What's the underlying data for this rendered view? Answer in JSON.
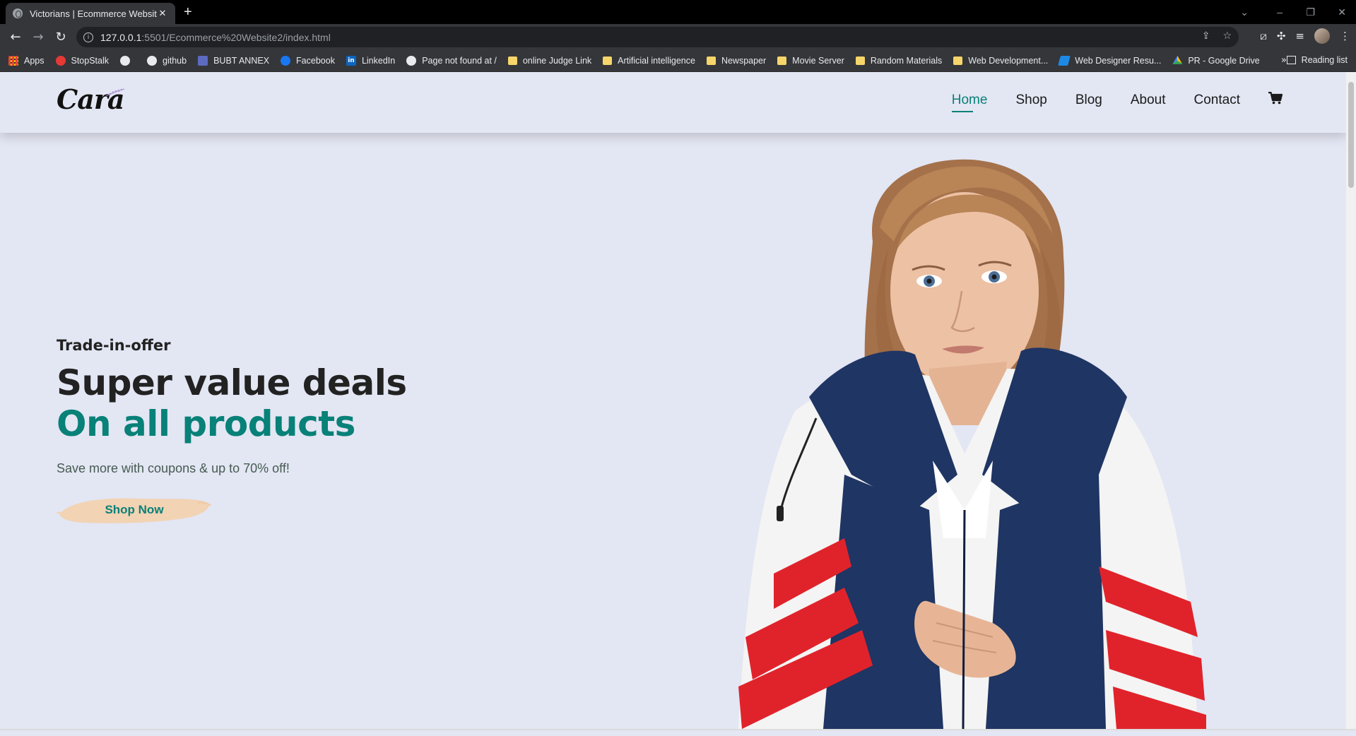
{
  "browser": {
    "tab_title": "Victorians | Ecommerce Website",
    "tab_close": "✕",
    "new_tab": "+",
    "url_host": "127.0.0.1",
    "url_rest": ":5501/Ecommerce%20Website2/index.html",
    "bookmarks": [
      {
        "label": "Apps",
        "icon": "apps-icon"
      },
      {
        "label": "StopStalk",
        "icon": "stopstalk-icon"
      },
      {
        "label": "",
        "icon": "globe-icon"
      },
      {
        "label": "github",
        "icon": "github-icon"
      },
      {
        "label": "BUBT ANNEX",
        "icon": "bubt-icon"
      },
      {
        "label": "Facebook",
        "icon": "facebook-icon"
      },
      {
        "label": "LinkedIn",
        "icon": "linkedin-icon"
      },
      {
        "label": "Page not found at /",
        "icon": "globe-icon"
      },
      {
        "label": "online Judge Link",
        "icon": "folder-icon"
      },
      {
        "label": "Artificial intelligence",
        "icon": "folder-icon"
      },
      {
        "label": "Newspaper",
        "icon": "folder-icon"
      },
      {
        "label": "Movie Server",
        "icon": "folder-icon"
      },
      {
        "label": "Random Materials",
        "icon": "folder-icon"
      },
      {
        "label": "Web Development...",
        "icon": "folder-icon"
      },
      {
        "label": "Web Designer Resu...",
        "icon": "web-designer-icon"
      },
      {
        "label": "PR - Google Drive",
        "icon": "google-drive-icon"
      }
    ],
    "more_bookmarks": "»",
    "reading_list": "Reading list"
  },
  "site": {
    "logo": "Cara",
    "nav": [
      {
        "label": "Home",
        "active": true
      },
      {
        "label": "Shop",
        "active": false
      },
      {
        "label": "Blog",
        "active": false
      },
      {
        "label": "About",
        "active": false
      },
      {
        "label": "Contact",
        "active": false
      }
    ],
    "cart_icon": "cart-icon"
  },
  "hero": {
    "subtitle": "Trade-in-offer",
    "heading": "Super value deals",
    "heading_accent": "On all products",
    "text": "Save more with coupons & up to 70% off!",
    "button": "Shop Now"
  },
  "colors": {
    "page_bg": "#e3e6f3",
    "accent": "#088178",
    "button_bg": "#f2d3b4",
    "heading": "#222222"
  }
}
